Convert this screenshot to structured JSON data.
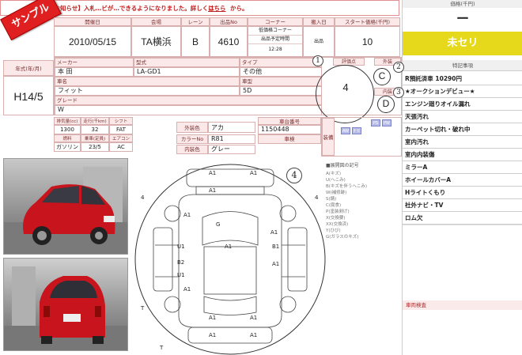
{
  "notice": {
    "text": "【お知らせ】入札…ビが…できるようになりました。詳しくは",
    "link": "こちら",
    "suffix": "から。"
  },
  "sample_banner": "サンプル",
  "header": {
    "labels": {
      "date": "開催日",
      "venue": "会場",
      "lane": "レーン",
      "number": "出品No",
      "corner": "コーナー",
      "entry": "搬入日",
      "start": "スタート価格(千円)"
    },
    "date": "2010/05/15",
    "venue": "TA横浜",
    "lane": "B",
    "number": "4610",
    "corner_name": "低価格コーナー",
    "corner_time_label": "出品予定時間",
    "corner_time": "12:28",
    "entry_label": "出品",
    "start_price": "10"
  },
  "price_panel": {
    "label": "価格(千円)",
    "price": "ー",
    "status": "未セリ",
    "notes_title": "特記事項",
    "notes": [
      "R預託済車 10290円",
      "★オークションデビュー★",
      "エンジン廻りオイル漏れ",
      "天張汚れ",
      "カーペット切れ・破れ中",
      "室内汚れ",
      "室内内装傷",
      "ミラーA",
      "ホイールカバーA",
      "Hライトくもり",
      "社外ナビ・TV",
      "ロム欠"
    ],
    "memo_label": "車両検査"
  },
  "vehicle": {
    "year_label": "年式(年/月)",
    "year": "H14/5",
    "maker_label": "メーカー",
    "maker": "本 田",
    "model_code_label": "型式",
    "model_code": "LA-GD1",
    "type_label": "タイプ",
    "type": "その他",
    "name_label": "車名",
    "name": "フィット",
    "body_label": "車型",
    "body": "5D",
    "grade_label": "グレード",
    "grade": "W"
  },
  "specs": {
    "labels": [
      "排気量(cc)",
      "走行(千km)",
      "シフト",
      "燃料",
      "乗車(定員)",
      "エアコン"
    ],
    "values": [
      "1300",
      "32",
      "FAT",
      "ガソリン",
      "23/5",
      "AC"
    ],
    "ext_color_label": "外装色",
    "ext_color": "アカ",
    "color_no_label": "カラーNo",
    "color_no": "R81",
    "int_color_label": "内装色",
    "int_color": "グレー",
    "chassis_label": "車台番号",
    "chassis": "1150448",
    "inspection_label": "車検"
  },
  "score": {
    "circle1": "1",
    "circle2": "2",
    "circle3": "3",
    "circle4": "4",
    "overall_label": "評価点",
    "overall": "4",
    "exterior_label": "外装",
    "exterior": "C",
    "interior_label": "内装",
    "interior": "D",
    "equip_label": "装備",
    "equip_buttons": [
      "PS",
      "PW",
      "AW",
      "ナビ"
    ]
  },
  "diagram": {
    "legend_title": "■展開図の記号",
    "legend": [
      "A(キズ)",
      "U(へこみ)",
      "B(キズを伴うへこみ)",
      "W(補修跡)",
      "S(錆)",
      "C(腐食)",
      "P(塗装剥げ)",
      "X(交換要)",
      "XX(交換済)",
      "Y(ひび)",
      "G(ガラスのキズ)"
    ],
    "marks": [
      "A1",
      "A1",
      "A1",
      "A1",
      "G",
      "A1",
      "U1",
      "B1",
      "B2",
      "A1",
      "U1",
      "A1",
      "A1",
      "A1",
      "A1",
      "A1",
      "A1"
    ],
    "bracket_labels": [
      "4",
      "4",
      "T",
      "T"
    ],
    "circle4": "4"
  }
}
